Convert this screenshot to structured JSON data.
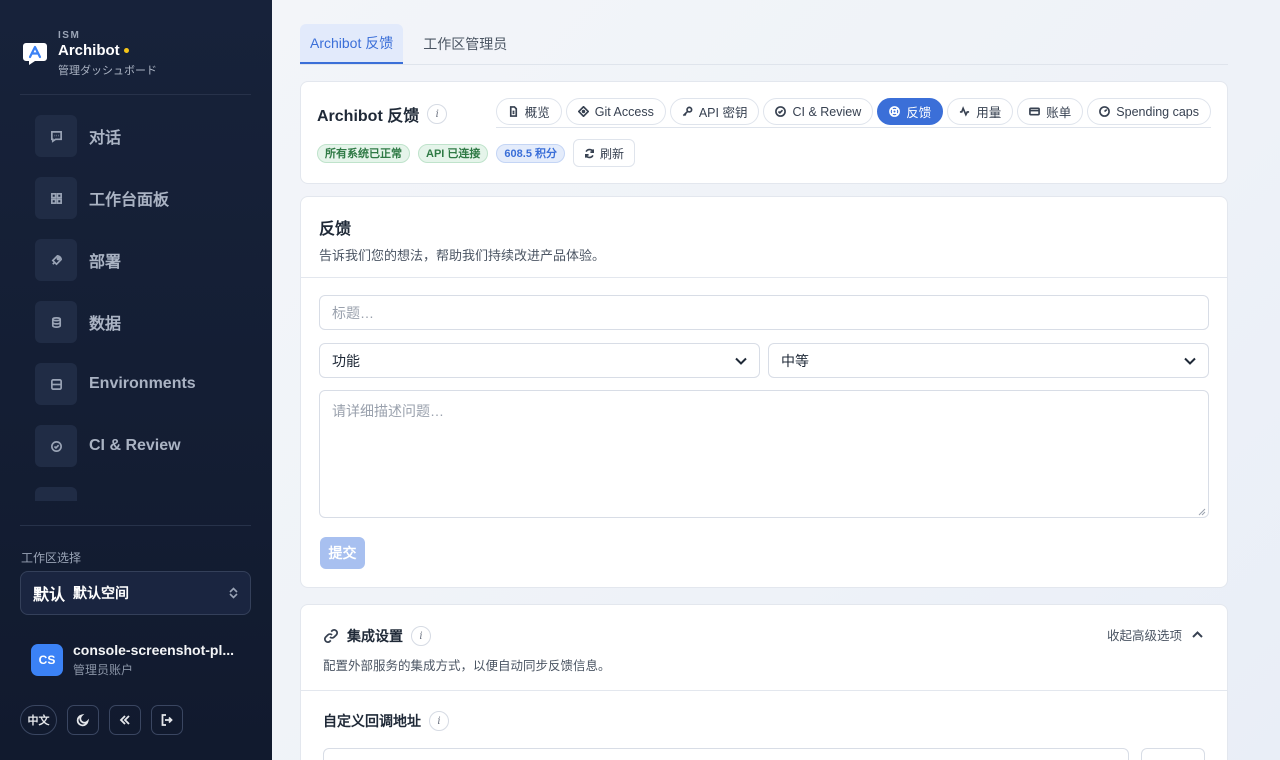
{
  "sidebar": {
    "brand_small": "ISM",
    "brand_name": "Archibot",
    "brand_sub": "管理ダッシュボード",
    "nav": [
      {
        "label": "对话",
        "icon": "chat-icon"
      },
      {
        "label": "工作台面板",
        "icon": "grid-icon"
      },
      {
        "label": "部署",
        "icon": "rocket-icon"
      },
      {
        "label": "数据",
        "icon": "database-icon"
      },
      {
        "label": "Environments",
        "icon": "server-icon"
      },
      {
        "label": "CI & Review",
        "icon": "check-circle-icon"
      }
    ],
    "workspace_label": "工作区选择",
    "workspace_flag": "默认",
    "workspace_name": "默认空间",
    "user_initials": "CS",
    "user_name": "console-screenshot-pl...",
    "user_role": "管理员账户",
    "lang_label": "中文"
  },
  "tabs": [
    {
      "label": "Archibot 反馈",
      "active": true
    },
    {
      "label": "工作区管理员"
    }
  ],
  "header": {
    "title": "Archibot 反馈",
    "badges": [
      "所有系统已正常",
      "API 已连接",
      "608.5 积分"
    ],
    "refresh_label": "刷新"
  },
  "console_tabs": [
    {
      "label": "概览",
      "icon": "file-icon"
    },
    {
      "label": "Git Access",
      "icon": "git-icon"
    },
    {
      "label": "API 密钥",
      "icon": "key-icon"
    },
    {
      "label": "CI & Review",
      "icon": "check-circle-icon"
    },
    {
      "label": "反馈",
      "icon": "lifebuoy-icon",
      "active": true
    },
    {
      "label": "用量",
      "icon": "activity-icon"
    },
    {
      "label": "账单",
      "icon": "card-icon"
    },
    {
      "label": "Spending caps",
      "icon": "gauge-icon"
    }
  ],
  "feedback": {
    "title": "反馈",
    "description": "告诉我们您的想法，帮助我们持续改进产品体验。",
    "title_placeholder": "标题…",
    "category_value": "功能",
    "priority_value": "中等",
    "body_placeholder": "请详细描述问题…",
    "submit_label": "提交"
  },
  "integration": {
    "title": "集成设置",
    "description": "配置外部服务的集成方式，以便自动同步反馈信息。",
    "toggle_label": "收起高级选项",
    "sub_title": "自定义回调地址"
  }
}
